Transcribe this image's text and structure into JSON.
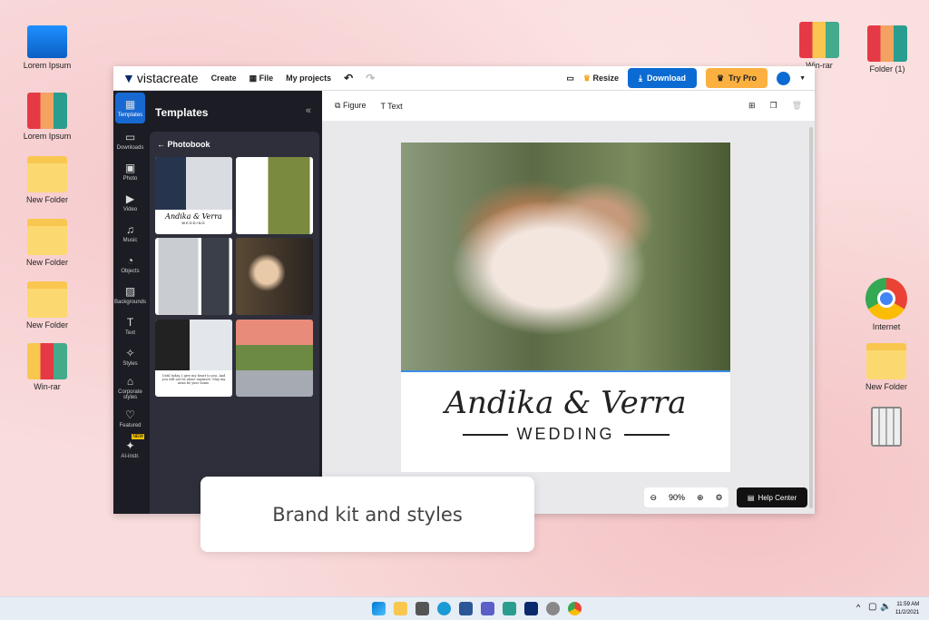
{
  "desktop": {
    "left_icons": [
      "Lorem Ipsum",
      "Lorem Ipsum",
      "New Folder",
      "New Folder",
      "New Folder",
      "Win-rar"
    ],
    "right_icons": [
      "Win-rar",
      "Folder (1)",
      "Internet",
      "New Folder",
      ""
    ]
  },
  "app": {
    "logo": "vistacreate",
    "menu": [
      "Create",
      "File",
      "My projects"
    ],
    "resize": "Resize",
    "download": "Download",
    "try_pro": "Try Pro",
    "rail": [
      "Templates",
      "Downloads",
      "Photo",
      "Video",
      "Music",
      "Objects",
      "Backgrounds",
      "Text",
      "Styles",
      "Corporate styles",
      "Featured",
      "AI-instr."
    ],
    "new_badge": "NEW",
    "panel_title": "Templates",
    "back_label": "Photobook",
    "thumb1_names": "Andika & Verra",
    "thumb1_sub": "WEDDING",
    "thumb5_text": "Until today, I give my heart to you. And you will not be alone anymore. May my arms be your home.",
    "toolbar": {
      "figure": "Figure",
      "text": "Text"
    },
    "design": {
      "names": "Andika & Verra",
      "subtitle": "WEDDING"
    },
    "zoom": "90%",
    "help": "Help Center"
  },
  "callout": "Brand kit and styles",
  "taskbar": {
    "time": "11:59 AM",
    "date": "11/2/2021"
  }
}
